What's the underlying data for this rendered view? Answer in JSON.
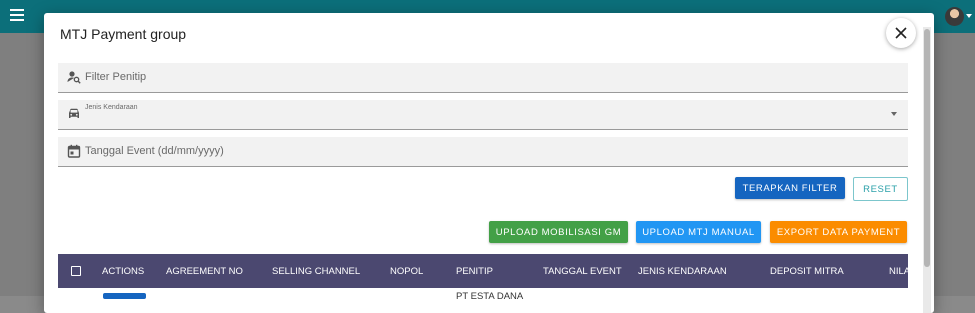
{
  "dialog": {
    "title": "MTJ Payment group"
  },
  "filters": {
    "penitip_placeholder": "Filter Penitip",
    "jenis_kendaraan_label": "Jenis Kendaraan",
    "tanggal_event_placeholder": "Tanggal Event (dd/mm/yyyy)"
  },
  "actions": {
    "apply": "TERAPKAN FILTER",
    "reset": "RESET",
    "upload_mobilisasi": "UPLOAD MOBILISASI GM",
    "upload_mtj_manual": "UPLOAD MTJ MANUAL",
    "export_payment": "EXPORT DATA PAYMENT"
  },
  "colors": {
    "appbar": "#0c6f7a",
    "apply": "#1565c0",
    "upload_mobilisasi": "#43a047",
    "upload_mtj_manual": "#2196f3",
    "export_payment": "#fb8c00",
    "table_header": "#4b4870"
  },
  "table": {
    "columns": [
      "ACTIONS",
      "AGREEMENT NO",
      "SELLING CHANNEL",
      "NOPOL",
      "PENITIP",
      "TANGGAL EVENT",
      "JENIS KENDARAAN",
      "DEPOSIT MITRA",
      "NILA"
    ],
    "first_row_penitip_partial": "PT ESTA DANA"
  },
  "icons": [
    "menu-icon",
    "avatar",
    "close-icon",
    "person-search-icon",
    "car-icon",
    "calendar-icon",
    "dropdown-arrow-icon",
    "checkbox-icon"
  ]
}
